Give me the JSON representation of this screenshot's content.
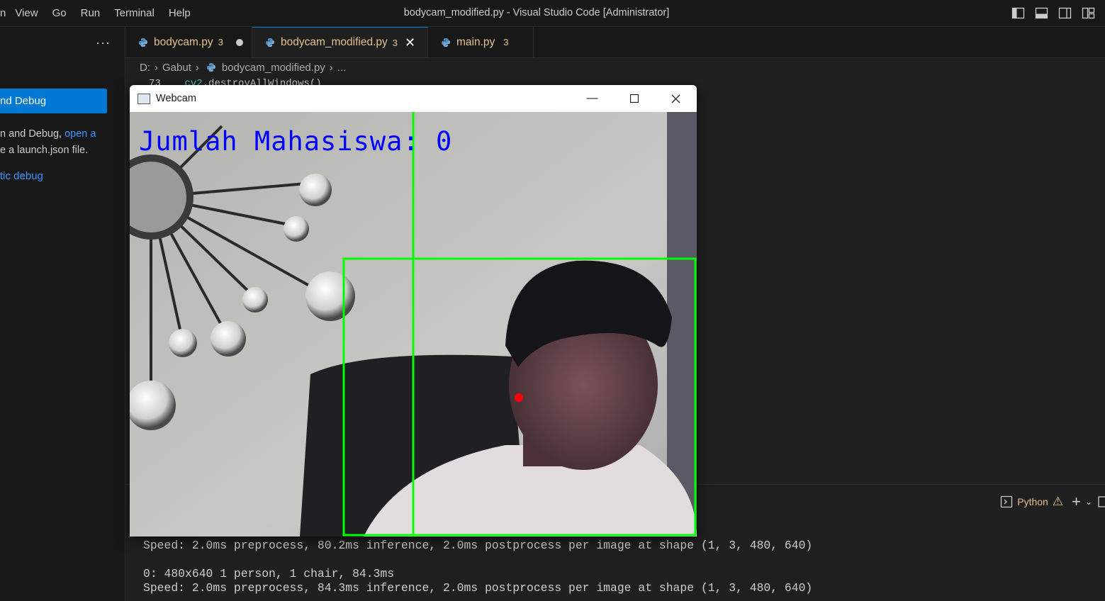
{
  "menu": {
    "items": [
      "n",
      "View",
      "Go",
      "Run",
      "Terminal",
      "Help"
    ]
  },
  "window_title": "bodycam_modified.py - Visual Studio Code [Administrator]",
  "sidebar": {
    "more": "···",
    "button_label": "nd Debug",
    "text_line1": "n and Debug, ",
    "text_link": "open a",
    "text_line2": "e a launch.json file.",
    "link2": "tic debug"
  },
  "tabs": [
    {
      "label": "bodycam.py",
      "count": "3",
      "state": "modified"
    },
    {
      "label": "bodycam_modified.py",
      "count": "3",
      "state": "active"
    },
    {
      "label": "main.py",
      "count": "3",
      "state": "normal"
    }
  ],
  "breadcrumb": {
    "drive": "D:",
    "folder": "Gabut",
    "file": "bodycam_modified.py",
    "more": "..."
  },
  "code": {
    "line_number": "73",
    "prefix": "cv2",
    "call": ".destroyAllWindows()"
  },
  "terminal": {
    "profile": "Python",
    "lines": [
      "Speed: 2.0ms preprocess, 80.2ms inference, 2.0ms postprocess per image at shape (1, 3, 480, 640)",
      "",
      "0: 480x640 1 person, 1 chair, 84.3ms",
      "Speed: 2.0ms preprocess, 84.3ms inference, 2.0ms postprocess per image at shape (1, 3, 480, 640)"
    ]
  },
  "webcam": {
    "title": "Webcam",
    "overlay_text": "Jumlah Mahasiswa: 0",
    "colors": {
      "box": "#00ff00",
      "text": "#0000ff",
      "point": "#ff0000"
    }
  },
  "colors": {
    "accent": "#0078d4",
    "tab_modified": "#e2c08d",
    "link": "#3794ff"
  }
}
